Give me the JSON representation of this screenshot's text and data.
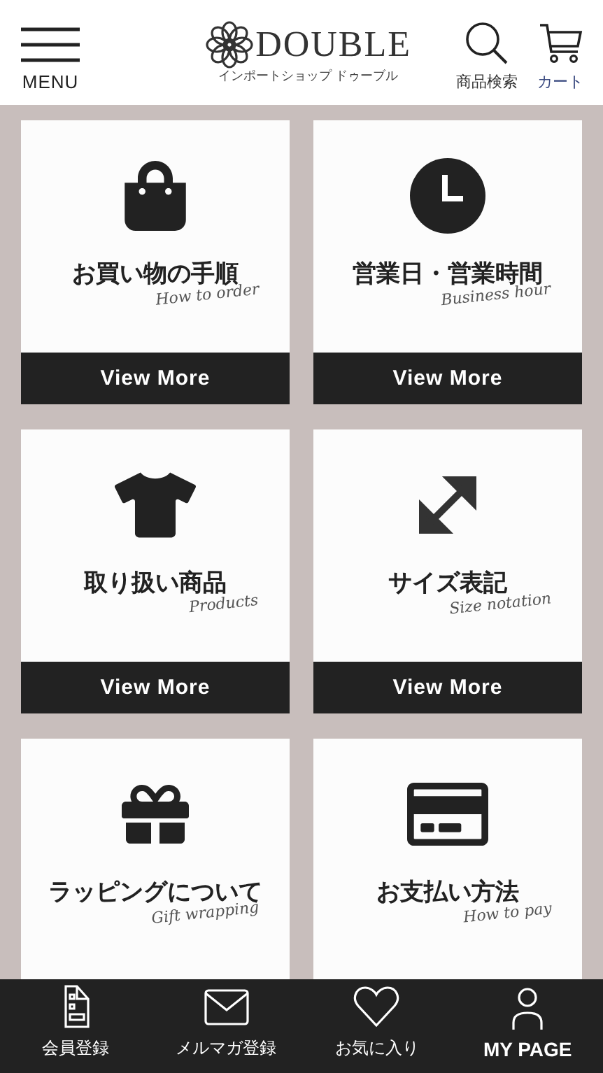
{
  "header": {
    "menu_label": "MENU",
    "logo": "DOUBLE",
    "logo_subtitle": "インポートショップ ドゥーブル",
    "search_label": "商品検索",
    "cart_label": "カート"
  },
  "cards": [
    {
      "kind": "bag",
      "title": "お買い物の手順",
      "subtitle": "How to order",
      "button": "View More"
    },
    {
      "kind": "clock",
      "title": "営業日・営業時間",
      "subtitle": "Business hour",
      "button": "View More"
    },
    {
      "kind": "shirt",
      "title": "取り扱い商品",
      "subtitle": "Products",
      "button": "View More"
    },
    {
      "kind": "arrows",
      "title": "サイズ表記",
      "subtitle": "Size notation",
      "button": "View More"
    },
    {
      "kind": "gift",
      "title": "ラッピングについて",
      "subtitle": "Gift wrapping"
    },
    {
      "kind": "card",
      "title": "お支払い方法",
      "subtitle": "How to pay"
    }
  ],
  "bottom_nav": [
    {
      "kind": "register",
      "label": "会員登録"
    },
    {
      "kind": "mail",
      "label": "メルマガ登録"
    },
    {
      "kind": "heart",
      "label": "お気に入り"
    },
    {
      "kind": "person",
      "label": "MY PAGE"
    }
  ]
}
